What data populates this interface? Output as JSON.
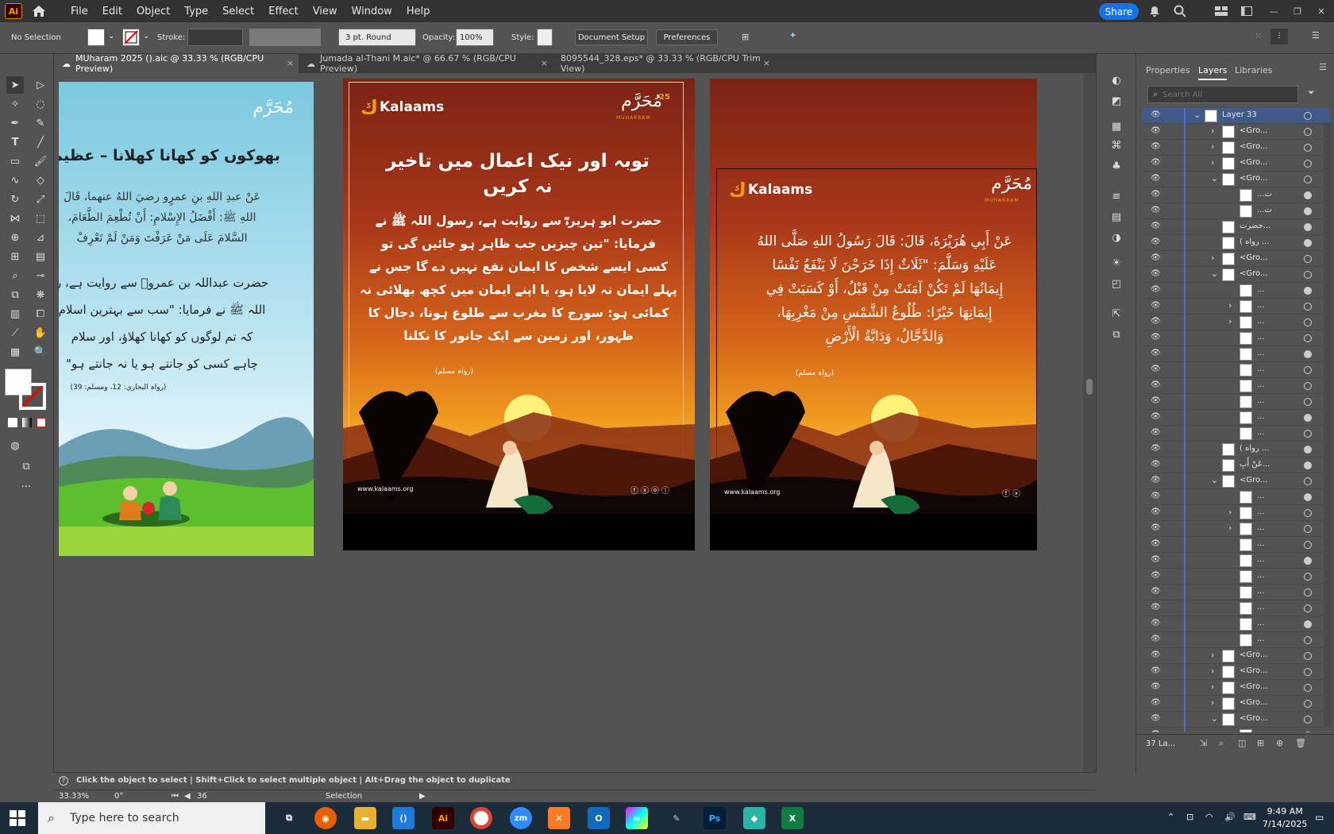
{
  "app": {
    "logo": "Ai",
    "menus": [
      "File",
      "Edit",
      "Object",
      "Type",
      "Select",
      "Effect",
      "View",
      "Window",
      "Help"
    ],
    "share": "Share"
  },
  "control": {
    "selection": "No Selection",
    "stroke_label": "Stroke:",
    "brush": "3 pt. Round",
    "opacity_label": "Opacity:",
    "opacity": "100%",
    "style_label": "Style:",
    "doc_setup": "Document Setup",
    "preferences": "Preferences"
  },
  "tabs": [
    {
      "label": "MUharam 2025 ().aic @ 33.33 % (RGB/CPU Preview)",
      "close": "×"
    },
    {
      "label": "Jumada al-Thani M.aic* @ 66.67 % (RGB/CPU Preview)",
      "close": "×"
    },
    {
      "label": "8095544_328.eps* @ 33.33 % (RGB/CPU Trim View)",
      "close": "×"
    }
  ],
  "artboard1": {
    "title": "بھوکوں کو کھانا کھلانا – عظیم",
    "arabic": [
      "عَنْ عبدِ اللهِ بنِ عمرٍو رضيَ اللهُ عنهما، قَالَ",
      "اللهِ ﷺ: أَفْضَلُ الإِسْلامِ: أَنْ تُطْعِمَ الطَّعَامَ،",
      "السَّلامَ عَلَى مَنْ عَرَفْتَ وَمَنْ لَمْ تَعْرِفْ"
    ],
    "urdu": [
      "حضرت عبداللہ بن عمروؓ سے روایت ہے، ر",
      "اللہ ﷺ نے فرمایا: \"سب سے بہترین اسلام",
      "کہ تم لوگوں کو کھانا کھلاؤ، اور سلام",
      "چاہے کسی کو جانتے ہو یا نہ جانتے ہو\""
    ],
    "ref": "(رواہ البخاري: 12، ومسلم: 39)",
    "logo": "مُحَرَّم"
  },
  "artboard2": {
    "brand": "Kalaams",
    "logo": "مُحَرَّم",
    "logo_num": "25",
    "logo_sub": "MUHARRAM",
    "title": [
      "توبہ اور نیک اعمال میں تاخیر",
      "نہ کریں"
    ],
    "body": [
      "حضرت ابو ہریرہؓ سے روایت ہے، رسول اللہ ﷺ نے",
      "فرمایا: \"تین چیزیں جب ظاہر ہو جائیں گی تو",
      "کسی ایسے شخص کا ایمان نفع نہیں دے گا جس نے",
      "پہلے ایمان نہ لایا ہو، یا اپنے ایمان میں کچھ بھلائی نہ",
      "کمائی ہو: سورج کا مغرب سے طلوع ہونا، دجال کا",
      "ظہور، اور زمین سے ایک جانور کا نکلنا"
    ],
    "ref": "(رواہ مسلم)",
    "url": "www.kalaams.org"
  },
  "artboard3": {
    "brand": "Kalaams",
    "logo": "مُحَرَّم",
    "logo_sub": "MUHARRAM",
    "arabic": [
      "عَنْ أَبِي هُرَيْرَةَ، قَالَ: قَالَ رَسُولُ اللهِ صَلَّى اللهُ",
      "عَلَيْهِ وَسَلَّمَ: \"ثَلَاثٌ إِذَا خَرَجْنَ لَا يَنْفَعُ نَفْسًا",
      "إِيمَانُهَا لَمْ تَكُنْ آمَنَتْ مِنْ قَبْلُ، أَوْ كَسَبَتْ فِي",
      "إِيمَانِهَا خَيْرًا: طُلُوعُ الشَّمْسِ مِنْ مَغْرِبِهَا،",
      "وَالدَّجَّالُ، وَدَابَّةُ الْأَرْضِ"
    ],
    "ref": "(رواہ مسلم)",
    "url": "www.kalaams.org"
  },
  "panel": {
    "tabs": [
      "Properties",
      "Layers",
      "Libraries"
    ],
    "search_placeholder": "Search All",
    "rows": [
      {
        "name": "Layer 33",
        "indent": 0,
        "arrow": "v",
        "target": "o"
      },
      {
        "name": "<Gro...",
        "indent": 1,
        "arrow": ">",
        "target": "o"
      },
      {
        "name": "<Gro...",
        "indent": 1,
        "arrow": ">",
        "target": "o"
      },
      {
        "name": "<Gro...",
        "indent": 1,
        "arrow": ">",
        "target": "o"
      },
      {
        "name": "<Gro...",
        "indent": 1,
        "arrow": "v",
        "target": "o"
      },
      {
        "name": "...ت",
        "indent": 2,
        "arrow": "",
        "target": "f"
      },
      {
        "name": "...ت",
        "indent": 2,
        "arrow": "",
        "target": "f"
      },
      {
        "name": "حضرت...",
        "indent": 1,
        "arrow": "",
        "target": "f"
      },
      {
        "name": "( رواه ...",
        "indent": 1,
        "arrow": "",
        "target": "f"
      },
      {
        "name": "<Gro...",
        "indent": 1,
        "arrow": ">",
        "target": "o"
      },
      {
        "name": "<Gro...",
        "indent": 1,
        "arrow": "v",
        "target": "o"
      },
      {
        "name": "...",
        "indent": 2,
        "arrow": "",
        "target": "f"
      },
      {
        "name": "...",
        "indent": 2,
        "arrow": ">",
        "target": "o"
      },
      {
        "name": "...",
        "indent": 2,
        "arrow": ">",
        "target": "o"
      },
      {
        "name": "...",
        "indent": 2,
        "arrow": "",
        "target": "o"
      },
      {
        "name": "...",
        "indent": 2,
        "arrow": "",
        "target": "f"
      },
      {
        "name": "...",
        "indent": 2,
        "arrow": "",
        "target": "o"
      },
      {
        "name": "...",
        "indent": 2,
        "arrow": "",
        "target": "o"
      },
      {
        "name": "...",
        "indent": 2,
        "arrow": "",
        "target": "o"
      },
      {
        "name": "...",
        "indent": 2,
        "arrow": "",
        "target": "f"
      },
      {
        "name": "...",
        "indent": 2,
        "arrow": "",
        "target": "o"
      },
      {
        "name": "( رواه ...",
        "indent": 1,
        "arrow": "",
        "target": "f"
      },
      {
        "name": "عَنْ أَبِ...",
        "indent": 1,
        "arrow": "",
        "target": "f"
      },
      {
        "name": "<Gro...",
        "indent": 1,
        "arrow": "v",
        "target": "o"
      },
      {
        "name": "...",
        "indent": 2,
        "arrow": "",
        "target": "f"
      },
      {
        "name": "...",
        "indent": 2,
        "arrow": ">",
        "target": "o"
      },
      {
        "name": "...",
        "indent": 2,
        "arrow": ">",
        "target": "o"
      },
      {
        "name": "...",
        "indent": 2,
        "arrow": "",
        "target": "o"
      },
      {
        "name": "...",
        "indent": 2,
        "arrow": "",
        "target": "f"
      },
      {
        "name": "...",
        "indent": 2,
        "arrow": "",
        "target": "o"
      },
      {
        "name": "...",
        "indent": 2,
        "arrow": "",
        "target": "o"
      },
      {
        "name": "...",
        "indent": 2,
        "arrow": "",
        "target": "o"
      },
      {
        "name": "...",
        "indent": 2,
        "arrow": "",
        "target": "f"
      },
      {
        "name": "...",
        "indent": 2,
        "arrow": "",
        "target": "o"
      },
      {
        "name": "<Gro...",
        "indent": 1,
        "arrow": ">",
        "target": "o"
      },
      {
        "name": "<Gro...",
        "indent": 1,
        "arrow": ">",
        "target": "o"
      },
      {
        "name": "<Gro...",
        "indent": 1,
        "arrow": ">",
        "target": "o"
      },
      {
        "name": "<Gro...",
        "indent": 1,
        "arrow": ">",
        "target": "o"
      },
      {
        "name": "<Gro...",
        "indent": 1,
        "arrow": "v",
        "target": "o"
      },
      {
        "name": "...",
        "indent": 2,
        "arrow": ">",
        "target": "o"
      }
    ],
    "layer_count": "37 La..."
  },
  "status": {
    "hint": "Click the object to select  |  Shift+Click to select multiple object  |  Alt+Drag the object to duplicate",
    "zoom": "33.33%",
    "rotate": "0°",
    "artboard": "36",
    "tool": "Selection"
  },
  "taskbar": {
    "search": "Type here to search",
    "time": "9:49 AM",
    "date": "7/14/2025"
  }
}
